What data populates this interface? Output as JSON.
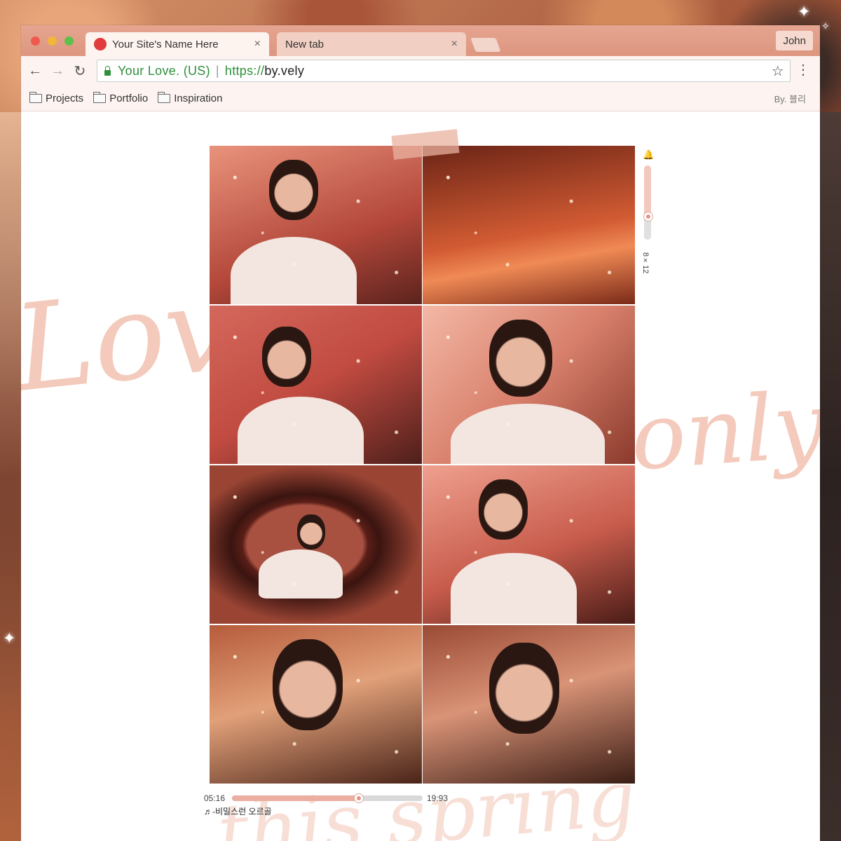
{
  "window": {
    "tabs": [
      {
        "title": "Your Site's Name Here",
        "close": "×"
      },
      {
        "title": "New tab",
        "close": "×"
      }
    ],
    "profile": "John"
  },
  "toolbar": {
    "back": "←",
    "forward": "→",
    "reload": "↻",
    "secure_label": "Your Love. (US)",
    "separator": "|",
    "url_scheme": "https://",
    "url_host": "by.vely",
    "star": "☆",
    "menu": "⋮"
  },
  "bookmarks": {
    "items": [
      "Projects",
      "Portfolio",
      "Inspiration"
    ],
    "right_text": "By. 블리"
  },
  "decor": {
    "script_left": "Love",
    "script_right": "only",
    "script_bottom": "this spring"
  },
  "volume": {
    "icon": "🔔",
    "label": "8×12",
    "level": 0.3
  },
  "player": {
    "elapsed": "05:16",
    "total": "19:93",
    "progress": 0.66,
    "track": "♬-비밀스런 오르골"
  },
  "colors": {
    "accent": "#e99f8c",
    "titlebar": "#dd9680",
    "secure_green": "#2f8f3a"
  }
}
